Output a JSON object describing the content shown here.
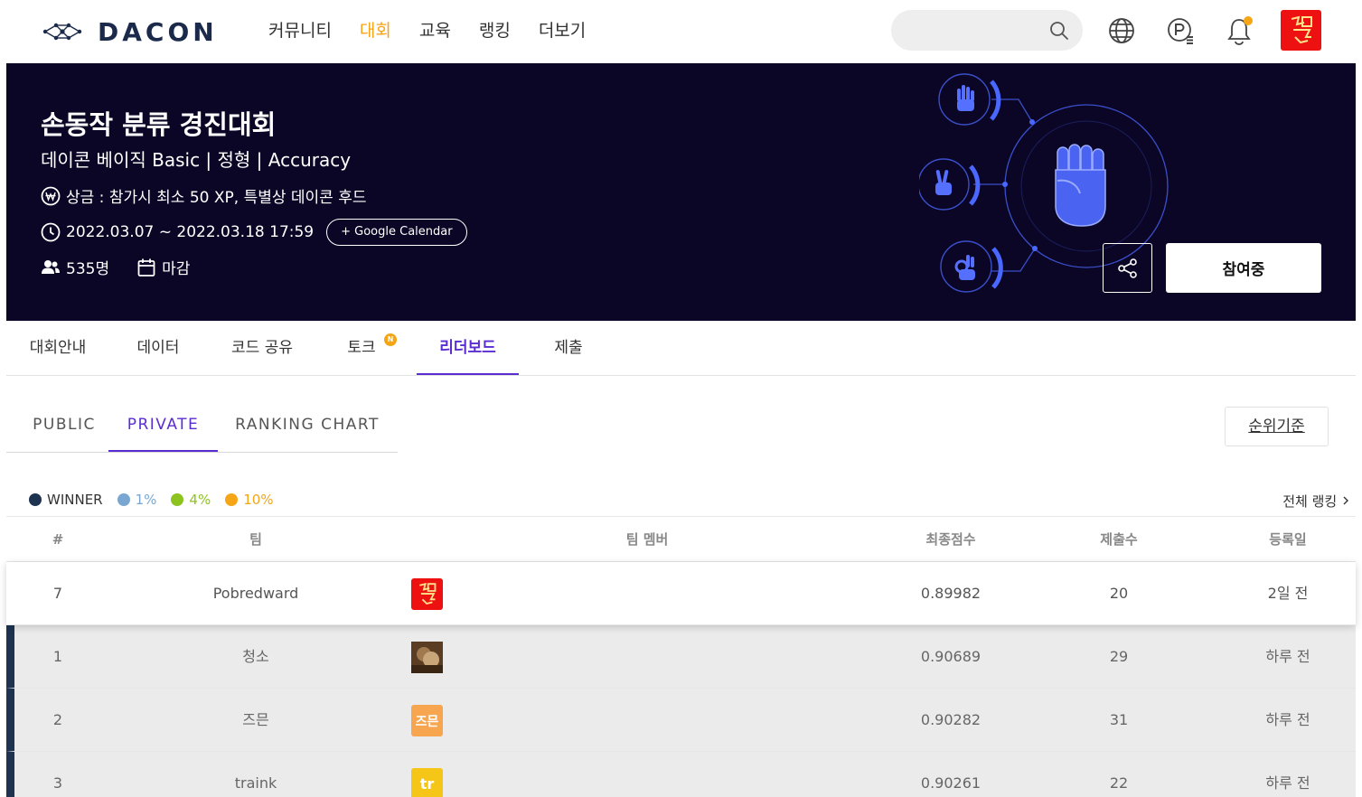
{
  "nav": {
    "logo_text": "DACON",
    "menu": [
      {
        "label": "커뮤니티",
        "active": false
      },
      {
        "label": "대회",
        "active": true
      },
      {
        "label": "교육",
        "active": false
      },
      {
        "label": "랭킹",
        "active": false
      },
      {
        "label": "더보기",
        "active": false
      }
    ],
    "search_placeholder": "",
    "icons": [
      "search-icon",
      "globe-icon",
      "points-icon",
      "bell-icon"
    ],
    "accent": "#f5a516"
  },
  "banner": {
    "title": "손동작 분류 경진대회",
    "subtitle": "데이콘 베이직 Basic | 정형 | Accuracy",
    "prize": "상금 : 참가시 최소 50 XP, 특별상 데이콘 후드",
    "period": "2022.03.07 ~ 2022.03.18 17:59",
    "calendar_button": "+ Google Calendar",
    "participants": "535명",
    "status": "마감",
    "join_button": "참여중",
    "background": "#0b0626"
  },
  "tabs": [
    {
      "label": "대회안내",
      "active": false,
      "badge": ""
    },
    {
      "label": "데이터",
      "active": false,
      "badge": ""
    },
    {
      "label": "코드 공유",
      "active": false,
      "badge": ""
    },
    {
      "label": "토크",
      "active": false,
      "badge": "N"
    },
    {
      "label": "리더보드",
      "active": true,
      "badge": ""
    },
    {
      "label": "제출",
      "active": false,
      "badge": ""
    }
  ],
  "subtabs": [
    {
      "label": "PUBLIC",
      "active": false
    },
    {
      "label": "PRIVATE",
      "active": true
    },
    {
      "label": "RANKING CHART",
      "active": false
    }
  ],
  "rank_criteria_button": "순위기준",
  "legend": [
    {
      "label": "WINNER",
      "color": "#1d3350"
    },
    {
      "label": "1%",
      "color": "#7aa7d1"
    },
    {
      "label": "4%",
      "color": "#8dc31f"
    },
    {
      "label": "10%",
      "color": "#f5a516"
    }
  ],
  "full_ranking_link": "전체 랭킹",
  "table": {
    "headers": [
      "#",
      "팀",
      "팀 멤버",
      "최종점수",
      "제출수",
      "등록일"
    ],
    "rows": [
      {
        "rank": "7",
        "team": "Pobredward",
        "avatar_text": "",
        "avatar_color": "#ee1111",
        "score": "0.89982",
        "submissions": "20",
        "date": "2일 전",
        "me": true
      },
      {
        "rank": "1",
        "team": "청소",
        "avatar_text": "",
        "avatar_color": "#6b4a2a",
        "score": "0.90689",
        "submissions": "29",
        "date": "하루 전",
        "me": false
      },
      {
        "rank": "2",
        "team": "즈믄",
        "avatar_text": "즈믄",
        "avatar_color": "#f7a54f",
        "score": "0.90282",
        "submissions": "31",
        "date": "하루 전",
        "me": false
      },
      {
        "rank": "3",
        "team": "traink",
        "avatar_text": "tr",
        "avatar_color": "#f5c518",
        "score": "0.90261",
        "submissions": "22",
        "date": "하루 전",
        "me": false
      }
    ]
  }
}
